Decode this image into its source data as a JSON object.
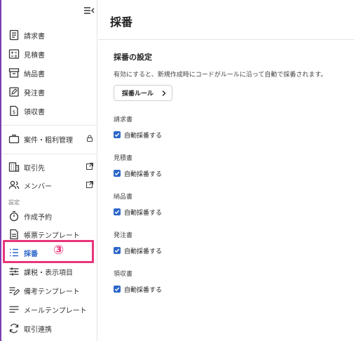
{
  "sidebar": {
    "items": [
      {
        "label": "請求書",
        "icon": "invoice-icon"
      },
      {
        "label": "見積書",
        "icon": "estimate-icon"
      },
      {
        "label": "納品書",
        "icon": "delivery-note-icon"
      },
      {
        "label": "発注書",
        "icon": "purchase-order-icon"
      },
      {
        "label": "領収書",
        "icon": "receipt-icon"
      },
      {
        "label": "案件・粗利管理",
        "icon": "briefcase-icon"
      },
      {
        "label": "取引先",
        "icon": "building-icon"
      },
      {
        "label": "メンバー",
        "icon": "members-icon"
      },
      {
        "label": "作成予約",
        "icon": "timer-icon"
      },
      {
        "label": "帳票テンプレート",
        "icon": "form-template-icon"
      },
      {
        "label": "採番",
        "icon": "numbering-list-icon"
      },
      {
        "label": "課税・表示項目",
        "icon": "sliders-icon"
      },
      {
        "label": "備考テンプレート",
        "icon": "note-edit-icon"
      },
      {
        "label": "メールテンプレート",
        "icon": "mail-lines-icon"
      },
      {
        "label": "取引連携",
        "icon": "sync-icon"
      }
    ],
    "settings_label": "設定",
    "active_item": "採番"
  },
  "annotation": {
    "callout": "③",
    "color": "#e8357a"
  },
  "main": {
    "title": "採番",
    "section_title": "採番の設定",
    "description": "有効にすると、新規作成時にコードがルールに沿って自動で採番されます。",
    "rule_button": "採番ルール",
    "doc_types": [
      {
        "label": "請求書",
        "checkbox_label": "自動採番する",
        "checked": true
      },
      {
        "label": "見積書",
        "checkbox_label": "自動採番する",
        "checked": true
      },
      {
        "label": "納品書",
        "checkbox_label": "自動採番する",
        "checked": true
      },
      {
        "label": "発注書",
        "checkbox_label": "自動採番する",
        "checked": true
      },
      {
        "label": "領収書",
        "checkbox_label": "自動採番する",
        "checked": true
      }
    ]
  },
  "colors": {
    "accent": "#2d67c9",
    "highlight": "#e8357a",
    "frame": "#7a3fb0"
  }
}
